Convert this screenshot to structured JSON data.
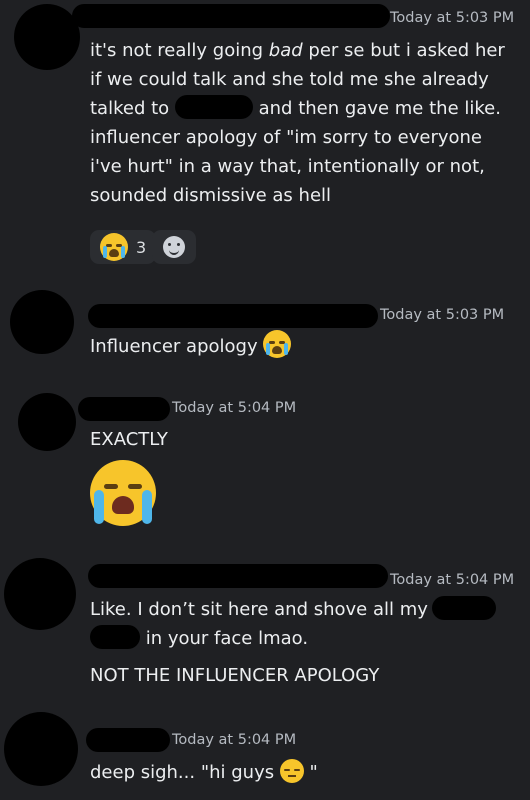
{
  "messages": [
    {
      "timestamp": "Today at 5:03 PM",
      "lines": {
        "l1_a": "it's not really going ",
        "l1_em": "bad",
        "l1_b": " per se but i asked her",
        "l2": "if we could talk and she told me she already",
        "l3_a": "talked to ",
        "l3_b": " and then gave me the like.",
        "l4": "influencer apology of \"im sorry to everyone",
        "l5": "i've hurt\" in a way that, intentionally or not,",
        "l6": "sounded dismissive as hell"
      },
      "reaction": {
        "emoji": "loudly-crying-face",
        "count": "3"
      }
    },
    {
      "timestamp": "Today at 5:03 PM",
      "text": "Influencer apology",
      "emoji": "loudly-crying-face"
    },
    {
      "timestamp": "Today at 5:04 PM",
      "text": "EXACTLY",
      "emoji": "loudly-crying-face"
    },
    {
      "timestamp": "Today at 5:04 PM",
      "l1": "Like. I don’t sit here and shove all my",
      "l2": " in your face lmao.",
      "l3": "NOT THE INFLUENCER APOLOGY"
    },
    {
      "timestamp": "Today at 5:04 PM",
      "text_a": "deep sigh... \"hi guys ",
      "text_b": " \"",
      "emoji": "pensive-face"
    }
  ],
  "colors": {
    "background": "#1f2023",
    "text": "#eceef0",
    "timestamp": "#b5bac1",
    "redaction": "#000000"
  }
}
